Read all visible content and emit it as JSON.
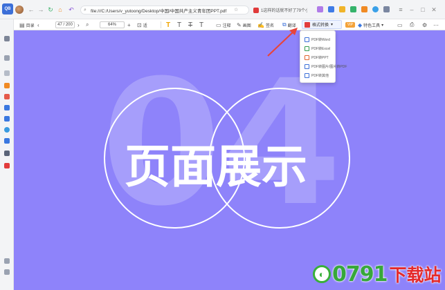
{
  "titlebar": {
    "address": "file:///C:/Users/v_yutoong/Desktop/中国/中国共产主义青年团PPT.pdf",
    "news": "1这样的话就不好了79个小"
  },
  "toolbar": {
    "catalog_label": "目录",
    "page_current": "47",
    "page_total": "/ 200",
    "zoom": "64%",
    "fit_label": "适",
    "tool_a": "注释",
    "tool_b": "画图",
    "tool_c": "签名",
    "tool_d": "翻译",
    "convert_label": "格式转换",
    "vip_label": "VIP",
    "special_tools": "特色工具"
  },
  "dropdown": {
    "items": [
      "PDF转Word",
      "PDF转Excel",
      "PDF转PPT",
      "PDF转图片/图片转PDF",
      "PDF转其他"
    ]
  },
  "slide": {
    "big_number": "04",
    "title": "页面展示"
  },
  "watermark": {
    "number": "0791",
    "text": "下载站"
  },
  "colors": {
    "slide_bg": "#8e83fa",
    "accent": "#3a6fd8",
    "watermark_green": "#37a83a",
    "watermark_red": "#e52a2a"
  }
}
